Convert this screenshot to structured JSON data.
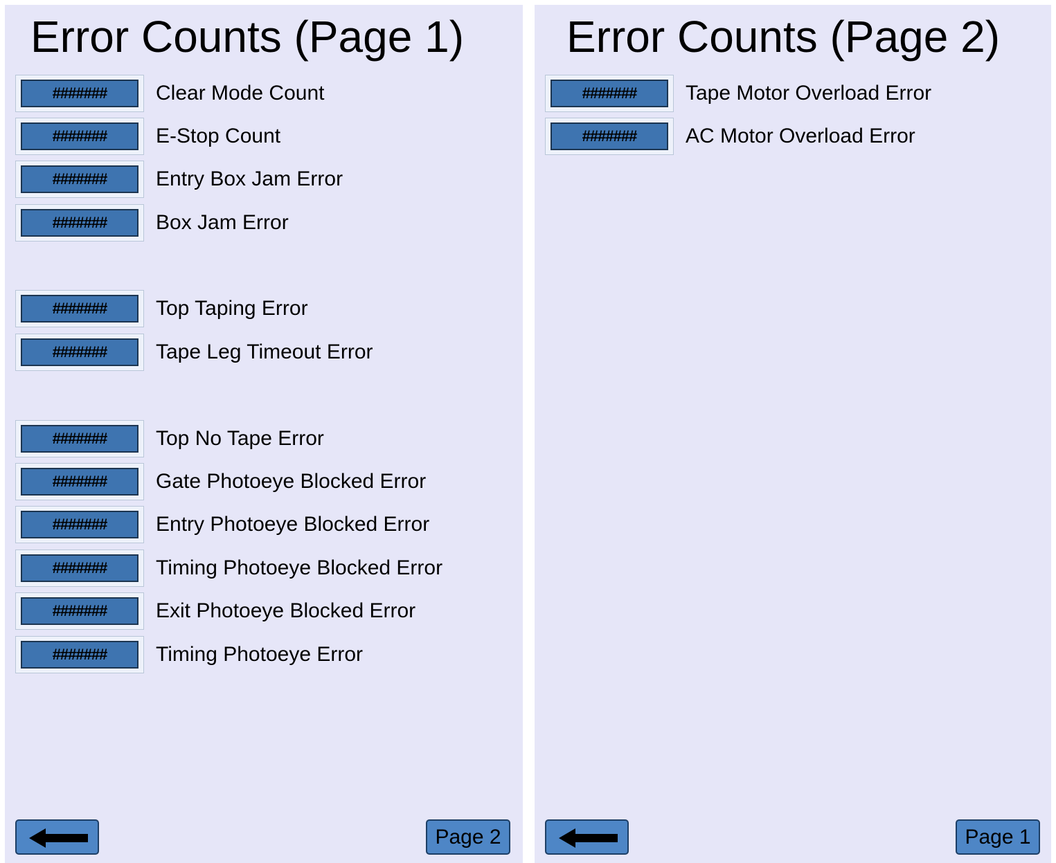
{
  "panel1": {
    "title": "Error Counts (Page 1)",
    "rows": [
      {
        "value": "#######",
        "label": "Clear Mode Count"
      },
      {
        "value": "#######",
        "label": "E-Stop Count"
      },
      {
        "value": "#######",
        "label": "Entry Box Jam Error"
      },
      {
        "value": "#######",
        "label": "Box Jam Error"
      },
      {
        "value": "#######",
        "label": "Top Taping Error"
      },
      {
        "value": "#######",
        "label": "Tape Leg Timeout Error"
      },
      {
        "value": "#######",
        "label": "Top No Tape Error"
      },
      {
        "value": "#######",
        "label": "Gate Photoeye Blocked Error"
      },
      {
        "value": "#######",
        "label": "Entry Photoeye Blocked Error"
      },
      {
        "value": "#######",
        "label": "Timing Photoeye Blocked Error"
      },
      {
        "value": "#######",
        "label": "Exit Photoeye Blocked Error"
      },
      {
        "value": "#######",
        "label": "Timing Photoeye Error"
      }
    ],
    "back_icon": "left-arrow-icon",
    "page_button": "Page 2"
  },
  "panel2": {
    "title": "Error Counts (Page 2)",
    "rows": [
      {
        "value": "#######",
        "label": "Tape Motor Overload Error"
      },
      {
        "value": "#######",
        "label": "AC Motor Overload Error"
      }
    ],
    "back_icon": "left-arrow-icon",
    "page_button": "Page 1"
  },
  "colors": {
    "panel_background": "#e6e6f8",
    "counter_fill": "#3e74b0",
    "button_fill": "#4e86c6"
  }
}
